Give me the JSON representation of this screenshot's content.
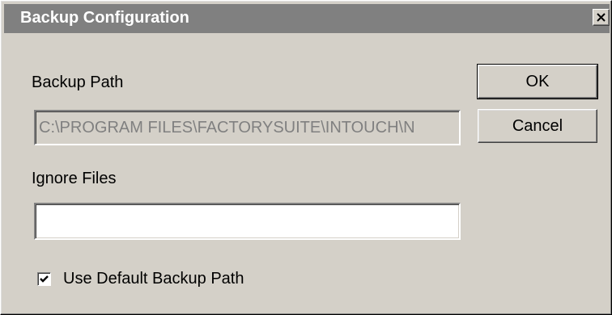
{
  "window": {
    "title": "Backup Configuration",
    "close_icon": "close-icon"
  },
  "backup_path": {
    "label": "Backup Path",
    "value": "C:\\PROGRAM FILES\\FACTORYSUITE\\INTOUCH\\N",
    "disabled": true
  },
  "ignore_files": {
    "label": "Ignore Files",
    "value": ""
  },
  "use_default": {
    "label": "Use Default Backup Path",
    "checked": true,
    "check_icon": "checkmark-icon"
  },
  "buttons": {
    "ok_label": "OK",
    "cancel_label": "Cancel"
  },
  "colors": {
    "face": "#d4d0c8",
    "titlebar_inactive": "#808080",
    "disabled_text": "#808080"
  }
}
